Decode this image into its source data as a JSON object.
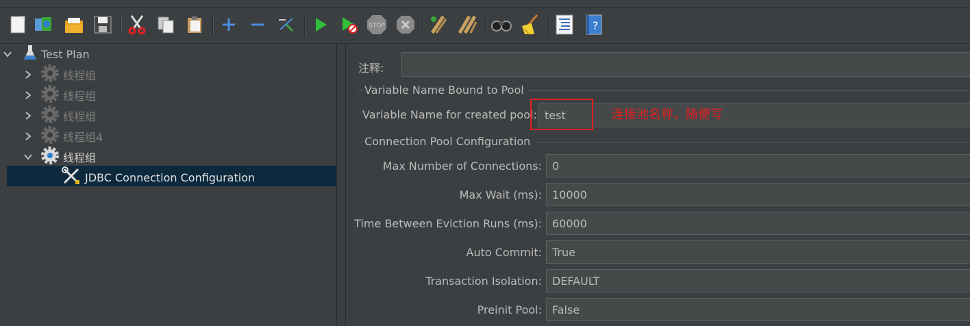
{
  "toolbar": {
    "buttons": [
      {
        "name": "new-icon"
      },
      {
        "name": "templates-icon"
      },
      {
        "name": "open-icon"
      },
      {
        "name": "save-icon"
      },
      {
        "name": "cut-icon"
      },
      {
        "name": "copy-icon"
      },
      {
        "name": "paste-icon"
      },
      {
        "name": "expand-icon"
      },
      {
        "name": "collapse-icon"
      },
      {
        "name": "toggle-icon"
      },
      {
        "name": "start-icon"
      },
      {
        "name": "start-no-pauses-icon"
      },
      {
        "name": "stop-icon"
      },
      {
        "name": "shutdown-icon"
      },
      {
        "name": "clear-icon"
      },
      {
        "name": "clear-all-icon"
      },
      {
        "name": "search-icon"
      },
      {
        "name": "reset-search-icon"
      },
      {
        "name": "function-helper-icon"
      },
      {
        "name": "help-icon"
      }
    ]
  },
  "tree": {
    "root": "Test Plan",
    "groups": [
      "线程组",
      "线程组",
      "线程组",
      "线程组4",
      "线程组"
    ],
    "selected": "JDBC Connection Configuration"
  },
  "form": {
    "comment_label": "注释:",
    "comment_value": "",
    "section_pool": "Variable Name Bound to Pool",
    "var_name_label": "Variable Name for created pool:",
    "var_name_value": "test",
    "annotation": "连接池名称，随便写",
    "section_config": "Connection Pool Configuration",
    "max_conn_label": "Max Number of Connections:",
    "max_conn_value": "0",
    "max_wait_label": "Max Wait (ms):",
    "max_wait_value": "10000",
    "eviction_label": "Time Between Eviction Runs (ms):",
    "eviction_value": "60000",
    "auto_commit_label": "Auto Commit:",
    "auto_commit_value": "True",
    "isolation_label": "Transaction Isolation:",
    "isolation_value": "DEFAULT",
    "preinit_label": "Preinit Pool:",
    "preinit_value": "False"
  },
  "colors": {
    "background": "#3c3f41",
    "selection": "#0d293e",
    "annotation": "#e02020"
  }
}
